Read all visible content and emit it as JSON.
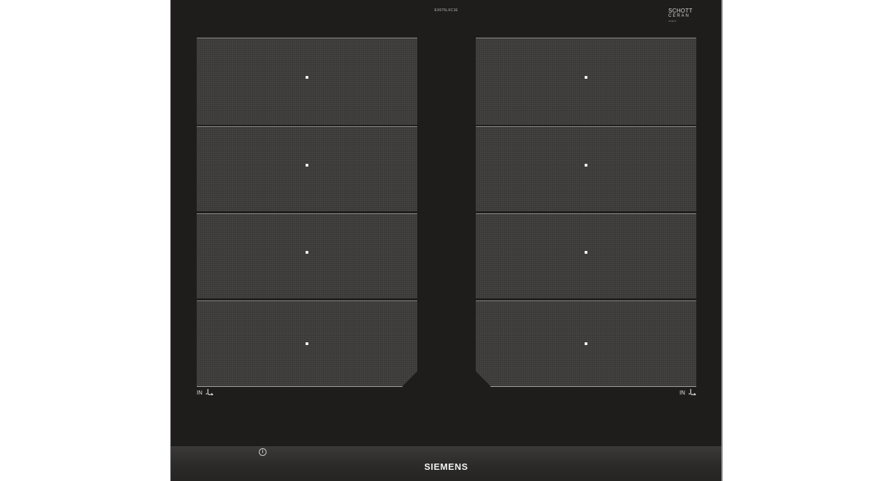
{
  "product": {
    "model_code": "EX675LXC1E",
    "glass_brand": {
      "line1": "SCHOTT",
      "line2": "CERAN",
      "line3": "designer"
    },
    "brand": "SIEMENS"
  },
  "zones": {
    "left_label": "IN",
    "right_label": "IN",
    "left_count": 4,
    "right_count": 4
  },
  "icons": {
    "flex_zone": "pan-icon",
    "info": "info-icon"
  },
  "colors": {
    "hob_glass": "#1e1d1c",
    "zone_fill": "#3a3938",
    "marker": "#f2f2f2"
  }
}
